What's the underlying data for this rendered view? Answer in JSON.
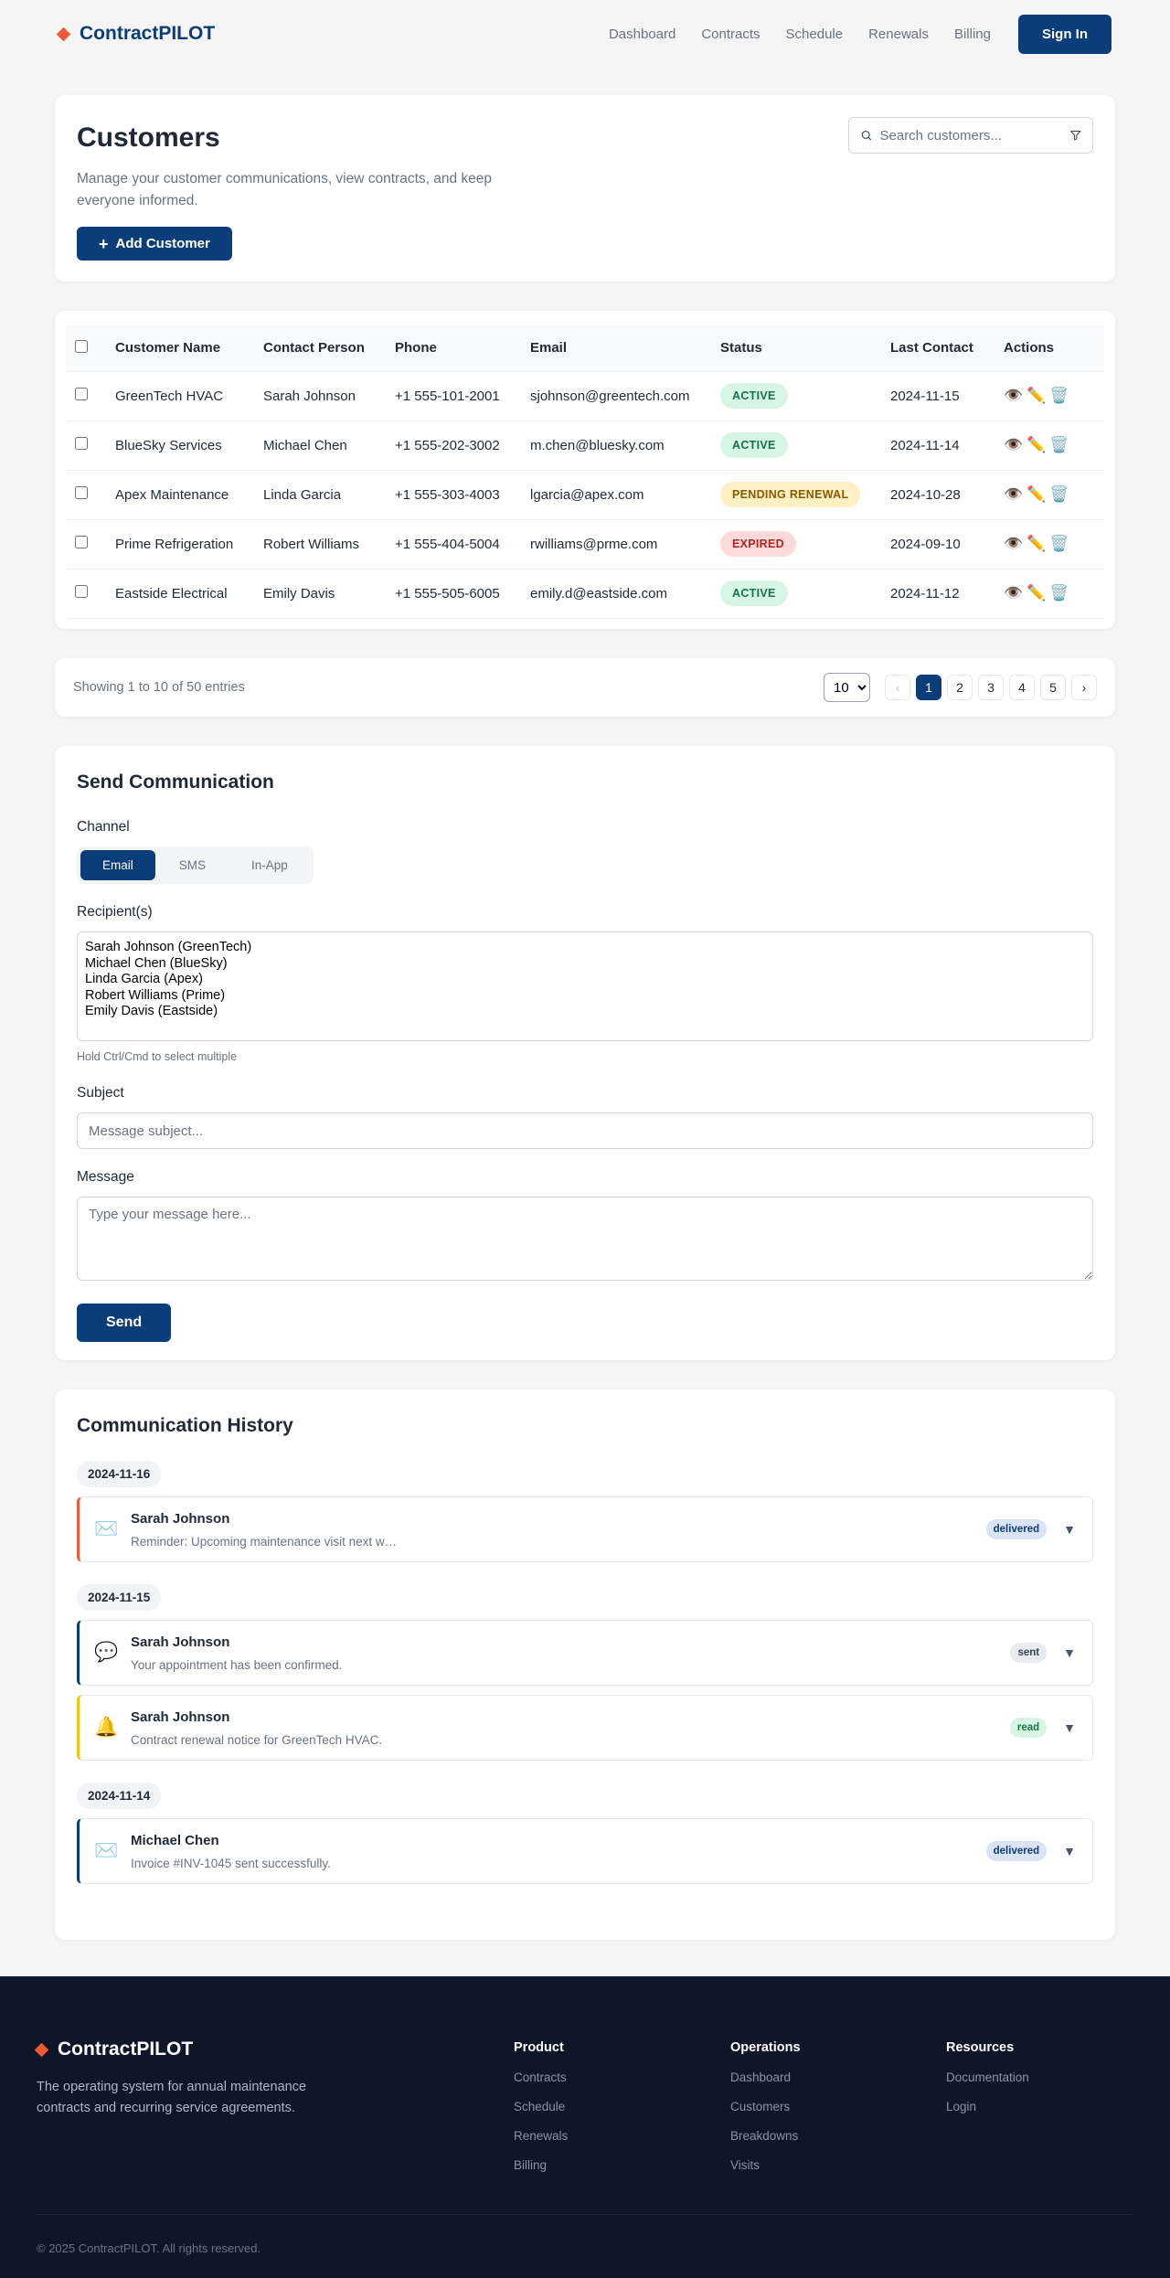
{
  "brand": {
    "name": "ContractPILOT"
  },
  "nav": {
    "items": [
      "Dashboard",
      "Contracts",
      "Schedule",
      "Renewals",
      "Billing"
    ],
    "signin": "Sign In"
  },
  "customers": {
    "title": "Customers",
    "description": "Manage your customer communications, view contracts, and keep everyone informed.",
    "add_button": "Add Customer",
    "search_placeholder": "Search customers..."
  },
  "table": {
    "headers": [
      "Customer Name",
      "Contact Person",
      "Phone",
      "Email",
      "Status",
      "Last Contact",
      "Actions"
    ],
    "rows": [
      {
        "name": "GreenTech HVAC",
        "contact": "Sarah Johnson",
        "phone": "+1 555-101-2001",
        "email": "sjohnson@greentech.com",
        "status": "ACTIVE",
        "last": "2024-11-15"
      },
      {
        "name": "BlueSky Services",
        "contact": "Michael Chen",
        "phone": "+1 555-202-3002",
        "email": "m.chen@bluesky.com",
        "status": "ACTIVE",
        "last": "2024-11-14"
      },
      {
        "name": "Apex Maintenance",
        "contact": "Linda Garcia",
        "phone": "+1 555-303-4003",
        "email": "lgarcia@apex.com",
        "status": "PENDING RENEWAL",
        "last": "2024-10-28"
      },
      {
        "name": "Prime Refrigeration",
        "contact": "Robert Williams",
        "phone": "+1 555-404-5004",
        "email": "rwilliams@prme.com",
        "status": "EXPIRED",
        "last": "2024-09-10"
      },
      {
        "name": "Eastside Electrical",
        "contact": "Emily Davis",
        "phone": "+1 555-505-6005",
        "email": "emily.d@eastside.com",
        "status": "ACTIVE",
        "last": "2024-11-12"
      }
    ]
  },
  "pagination": {
    "info": "Showing 1 to 10 of 50 entries",
    "page_size": "10",
    "prev": "‹",
    "next": "›",
    "pages": [
      "1",
      "2",
      "3",
      "4",
      "5"
    ],
    "current": "1"
  },
  "communication": {
    "title": "Send Communication",
    "channel_label": "Channel",
    "channels": [
      "Email",
      "SMS",
      "In-App"
    ],
    "selected_channel": "Email",
    "recipients_label": "Recipient(s)",
    "recipients": [
      "Sarah Johnson (GreenTech)",
      "Michael Chen (BlueSky)",
      "Linda Garcia (Apex)",
      "Robert Williams (Prime)",
      "Emily Davis (Eastside)"
    ],
    "hint": "Hold Ctrl/Cmd to select multiple",
    "subject_label": "Subject",
    "subject_placeholder": "Message subject...",
    "message_label": "Message",
    "message_placeholder": "Type your message here...",
    "send": "Send"
  },
  "history": {
    "title": "Communication History",
    "groups": [
      {
        "date": "2024-11-16",
        "items": [
          {
            "icon": "envelope-icon",
            "glyph": "✉️",
            "accent": "#ef5a35",
            "who": "Sarah Johnson",
            "text": "Reminder: Upcoming maintenance visit next w…",
            "status": "delivered"
          }
        ]
      },
      {
        "date": "2024-11-15",
        "items": [
          {
            "icon": "chat-bubble-icon",
            "glyph": "💬",
            "accent": "#0b3d7a",
            "who": "Sarah Johnson",
            "text": "Your appointment has been confirmed.",
            "status": "sent"
          },
          {
            "icon": "bell-icon",
            "glyph": "🔔",
            "accent": "#f2c30f",
            "who": "Sarah Johnson",
            "text": "Contract renewal notice for GreenTech HVAC.",
            "status": "read"
          }
        ]
      },
      {
        "date": "2024-11-14",
        "items": [
          {
            "icon": "envelope-icon",
            "glyph": "✉️",
            "accent": "#0b3d7a",
            "who": "Michael Chen",
            "text": "Invoice #INV-1045 sent successfully.",
            "status": "delivered"
          }
        ]
      }
    ]
  },
  "footer": {
    "tagline": "The operating system for annual maintenance contracts and recurring service agreements.",
    "columns": [
      {
        "title": "Product",
        "links": [
          "Contracts",
          "Schedule",
          "Renewals",
          "Billing"
        ]
      },
      {
        "title": "Operations",
        "links": [
          "Dashboard",
          "Customers",
          "Breakdowns",
          "Visits"
        ]
      },
      {
        "title": "Resources",
        "links": [
          "Documentation",
          "Login"
        ]
      }
    ],
    "copyright": "© 2025 ContractPILOT. All rights reserved."
  },
  "colors": {
    "primary": "#0b3d7a",
    "accent": "#ef5a35",
    "footer_bg": "#0e1628"
  }
}
